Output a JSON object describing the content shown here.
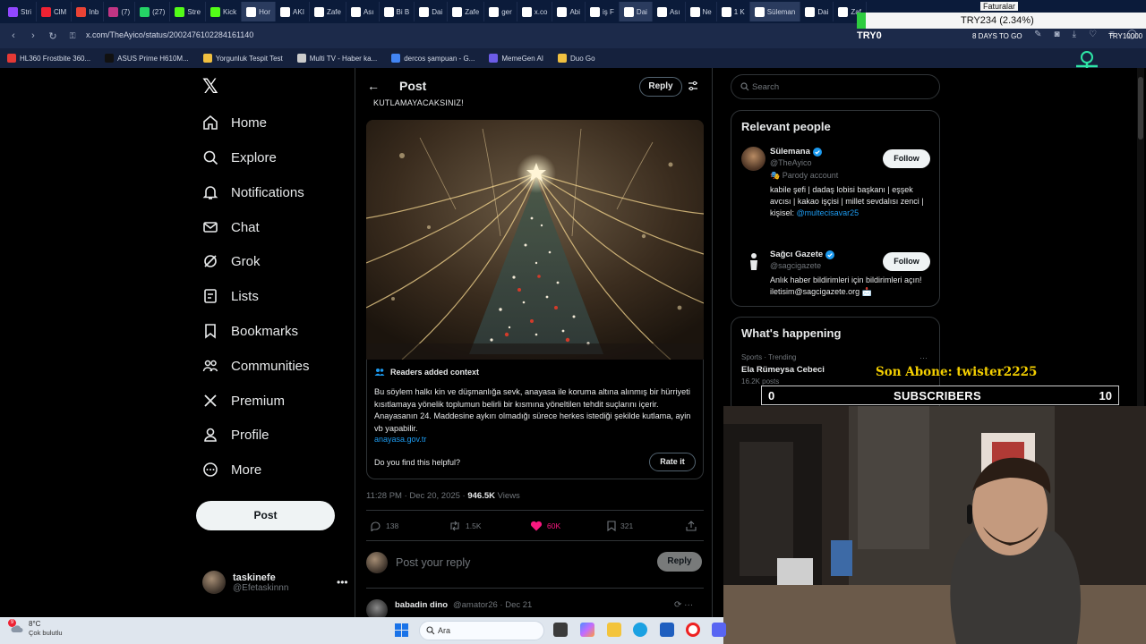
{
  "browser": {
    "tabs": [
      {
        "label": "Stri",
        "color": "#9147ff",
        "active": false
      },
      {
        "label": "ClM",
        "color": "#e23",
        "active": false
      },
      {
        "label": "Inb",
        "color": "#ea4335",
        "active": false
      },
      {
        "label": "(7)",
        "color": "#c13584",
        "active": false
      },
      {
        "label": "(27)",
        "color": "#25d366",
        "active": false
      },
      {
        "label": "Stre",
        "color": "#53fc18",
        "active": false
      },
      {
        "label": "Kick",
        "color": "#53fc18",
        "active": false
      },
      {
        "label": "Hor",
        "color": "#ffffff",
        "active": true
      },
      {
        "label": "AKI",
        "color": "#ffffff",
        "active": false
      },
      {
        "label": "Zafe",
        "color": "#ffffff",
        "active": false
      },
      {
        "label": "Ası",
        "color": "#ffffff",
        "active": false
      },
      {
        "label": "Bi B",
        "color": "#ffffff",
        "active": false
      },
      {
        "label": "Dai",
        "color": "#ffffff",
        "active": false
      },
      {
        "label": "Zafe",
        "color": "#ffffff",
        "active": false
      },
      {
        "label": "ger",
        "color": "#ffffff",
        "active": false
      },
      {
        "label": "x.co",
        "color": "#ffffff",
        "active": false
      },
      {
        "label": "Abi",
        "color": "#ffffff",
        "active": false
      },
      {
        "label": "iş F",
        "color": "#ffffff",
        "active": false
      },
      {
        "label": "Dai",
        "color": "#ffffff",
        "active": true
      },
      {
        "label": "Ası",
        "color": "#ffffff",
        "active": false
      },
      {
        "label": "Ne",
        "color": "#ffffff",
        "active": false
      },
      {
        "label": "1 K",
        "color": "#ffffff",
        "active": false
      },
      {
        "label": "Süleman",
        "color": "#ffffff",
        "active": true
      },
      {
        "label": "Dai",
        "color": "#ffffff",
        "active": false
      },
      {
        "label": "Zaf",
        "color": "#ffffff",
        "active": false
      }
    ],
    "url": "x.com/TheAyico/status/2002476102284161140",
    "bookmarks": [
      {
        "label": "HL360 Frostbite 360...",
        "color": "#e53935"
      },
      {
        "label": "ASUS Prime H610M...",
        "color": "#111111"
      },
      {
        "label": "Yorgunluk Tespit Test",
        "color": "#f0c040"
      },
      {
        "label": "Multi TV - Haber ka...",
        "color": "#cccccc"
      },
      {
        "label": "dercos şampuan - G...",
        "color": "#4285f4"
      },
      {
        "label": "MemeGen AI",
        "color": "#6c5ce7"
      },
      {
        "label": "Duo Go",
        "color": "#f0c040"
      }
    ]
  },
  "overlay": {
    "ticker": "TRY234 (2.34%)",
    "faturalar": "Faturalar",
    "try_left": "TRY0",
    "days_to_go": "8 DAYS TO GO",
    "try_right": "TRY10000",
    "son_abone": "Son Abone: twister2225",
    "subs_left": "0",
    "subs_label": "SUBSCRIBERS",
    "subs_right": "10"
  },
  "nav": {
    "items": [
      {
        "label": "Home",
        "icon": "home-icon"
      },
      {
        "label": "Explore",
        "icon": "search-icon"
      },
      {
        "label": "Notifications",
        "icon": "bell-icon"
      },
      {
        "label": "Chat",
        "icon": "mail-icon"
      },
      {
        "label": "Grok",
        "icon": "grok-icon"
      },
      {
        "label": "Lists",
        "icon": "list-icon"
      },
      {
        "label": "Bookmarks",
        "icon": "bookmark-icon"
      },
      {
        "label": "Communities",
        "icon": "people-icon"
      },
      {
        "label": "Premium",
        "icon": "x-icon"
      },
      {
        "label": "Profile",
        "icon": "person-icon"
      },
      {
        "label": "More",
        "icon": "more-icon"
      }
    ],
    "post_button": "Post",
    "user": {
      "name": "taskinefe",
      "handle": "@Efetaskinnn"
    }
  },
  "post": {
    "header_title": "Post",
    "reply_label": "Reply",
    "cut_text": "KUTLAMAYACAKSINIZ!",
    "context": {
      "title": "Readers added context",
      "body": "Bu söylem halkı kin ve düşmanlığa sevk, anayasa ile koruma altına alınmış bir hürriyeti kısıtlamaya yönelik toplumun belirli bir kısmına yöneltilen tehdit suçlarını içerir. Anayasanın 24. Maddesine aykırı olmadığı sürece herkes istediği şekilde kutlama, ayin vb yapabilir.",
      "link": "anayasa.gov.tr",
      "helpful_question": "Do you find this helpful?",
      "rate_label": "Rate it"
    },
    "timestamp": "11:28 PM · Dec 20, 2025 · ",
    "views_count": "946.5K",
    "views_label": " Views",
    "stats": {
      "replies": "138",
      "reposts": "1.5K",
      "likes": "60K",
      "bookmarks": "321"
    },
    "reply_placeholder": "Post your reply",
    "reply_button": "Reply",
    "comment": {
      "name": "babadin dino",
      "handle": "@amator26 · Dec 21"
    }
  },
  "right": {
    "search_placeholder": "Search",
    "relevant_title": "Relevant people",
    "people": [
      {
        "name": "Sülemana",
        "handle": "@TheAyico",
        "parody": "🎭 Parody account",
        "bio": "kabile şefi | dadaş lobisi başkanı | eşşek avcısı | kakao işçisi | millet sevdalısı zenci | kişisel: ",
        "bio_link": "@multecisavar25",
        "follow": "Follow"
      },
      {
        "name": "Sağcı Gazete",
        "handle": "@sagcigazete",
        "bio": "Anlık haber bildirimleri için bildirimleri açın! iletisim@sagcigazete.org 📩",
        "follow": "Follow"
      }
    ],
    "happening_title": "What's happening",
    "trends": [
      {
        "meta": "Sports · Trending",
        "name": "Ela Rümeysa Cebeci",
        "posts": "16.2K posts"
      }
    ]
  },
  "taskbar": {
    "temp": "8°C",
    "weather": "Çok bulutlu",
    "weather_badge": "9",
    "search": "Ara"
  },
  "colors": {
    "accent": "#1d9bf0",
    "like": "#f91880",
    "verified": "#1d9bf0"
  }
}
